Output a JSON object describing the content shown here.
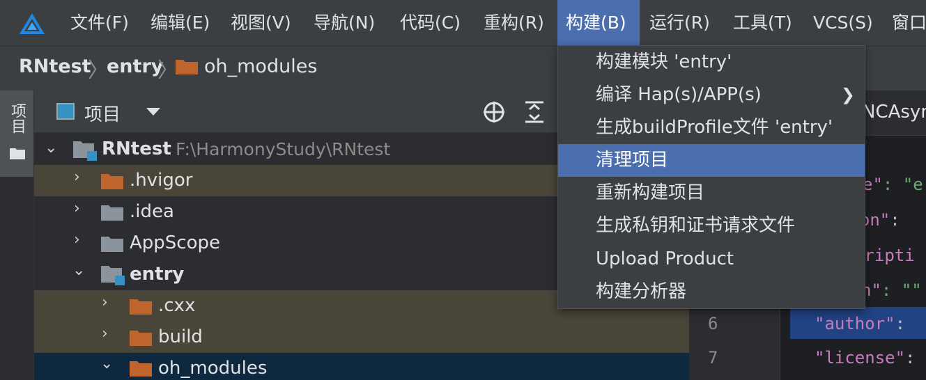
{
  "menubar": {
    "items": [
      {
        "label": "文件(F)"
      },
      {
        "label": "编辑(E)"
      },
      {
        "label": "视图(V)"
      },
      {
        "label": "导航(N)"
      },
      {
        "label": "代码(C)"
      },
      {
        "label": "重构(R)"
      },
      {
        "label": "构建(B)"
      },
      {
        "label": "运行(R)"
      },
      {
        "label": "工具(T)"
      },
      {
        "label": "VCS(S)"
      },
      {
        "label": "窗口"
      }
    ],
    "active": "构建(B)"
  },
  "breadcrumb": [
    "RNtest",
    "entry",
    "oh_modules"
  ],
  "toolstrip": {
    "project_label": "项目"
  },
  "project_panel": {
    "title": "项目"
  },
  "tree": {
    "root": {
      "label": "RNtest",
      "path": "F:\\HarmonyStudy\\RNtest"
    },
    "items": [
      {
        "label": ".hvigor"
      },
      {
        "label": ".idea"
      },
      {
        "label": "AppScope"
      },
      {
        "label": "entry"
      },
      {
        "label": ".cxx"
      },
      {
        "label": "build"
      },
      {
        "label": "oh_modules"
      }
    ]
  },
  "editor": {
    "tab": "NCAsyn",
    "line_numbers": [
      "6",
      "7"
    ],
    "code_lines": [
      {
        "key": "e\"",
        "rest": ": \"e"
      },
      {
        "key": "sion\"",
        "rest": ":"
      },
      {
        "key": "cripti",
        "rest": ""
      },
      {
        "key": "n\"",
        "rest": ": \"\""
      },
      {
        "key": "\"author\"",
        "rest": ":"
      },
      {
        "key": "\"license\"",
        "rest": ":"
      }
    ]
  },
  "build_menu": {
    "items": [
      {
        "label": "构建模块 'entry'"
      },
      {
        "label": "编译 Hap(s)/APP(s)",
        "submenu_arrow": "❯"
      },
      {
        "label": "生成buildProfile文件 'entry'"
      },
      {
        "label": "清理项目"
      },
      {
        "label": "重新构建项目"
      },
      {
        "label": "生成私钥和证书请求文件"
      },
      {
        "label": "Upload Product"
      },
      {
        "label": "构建分析器"
      }
    ],
    "selected": "清理项目"
  },
  "colors": {
    "accent": "#4b6eaf",
    "folder_orange": "#c0642e",
    "folder_gray": "#8b949c",
    "module_badge": "#3592c4"
  }
}
